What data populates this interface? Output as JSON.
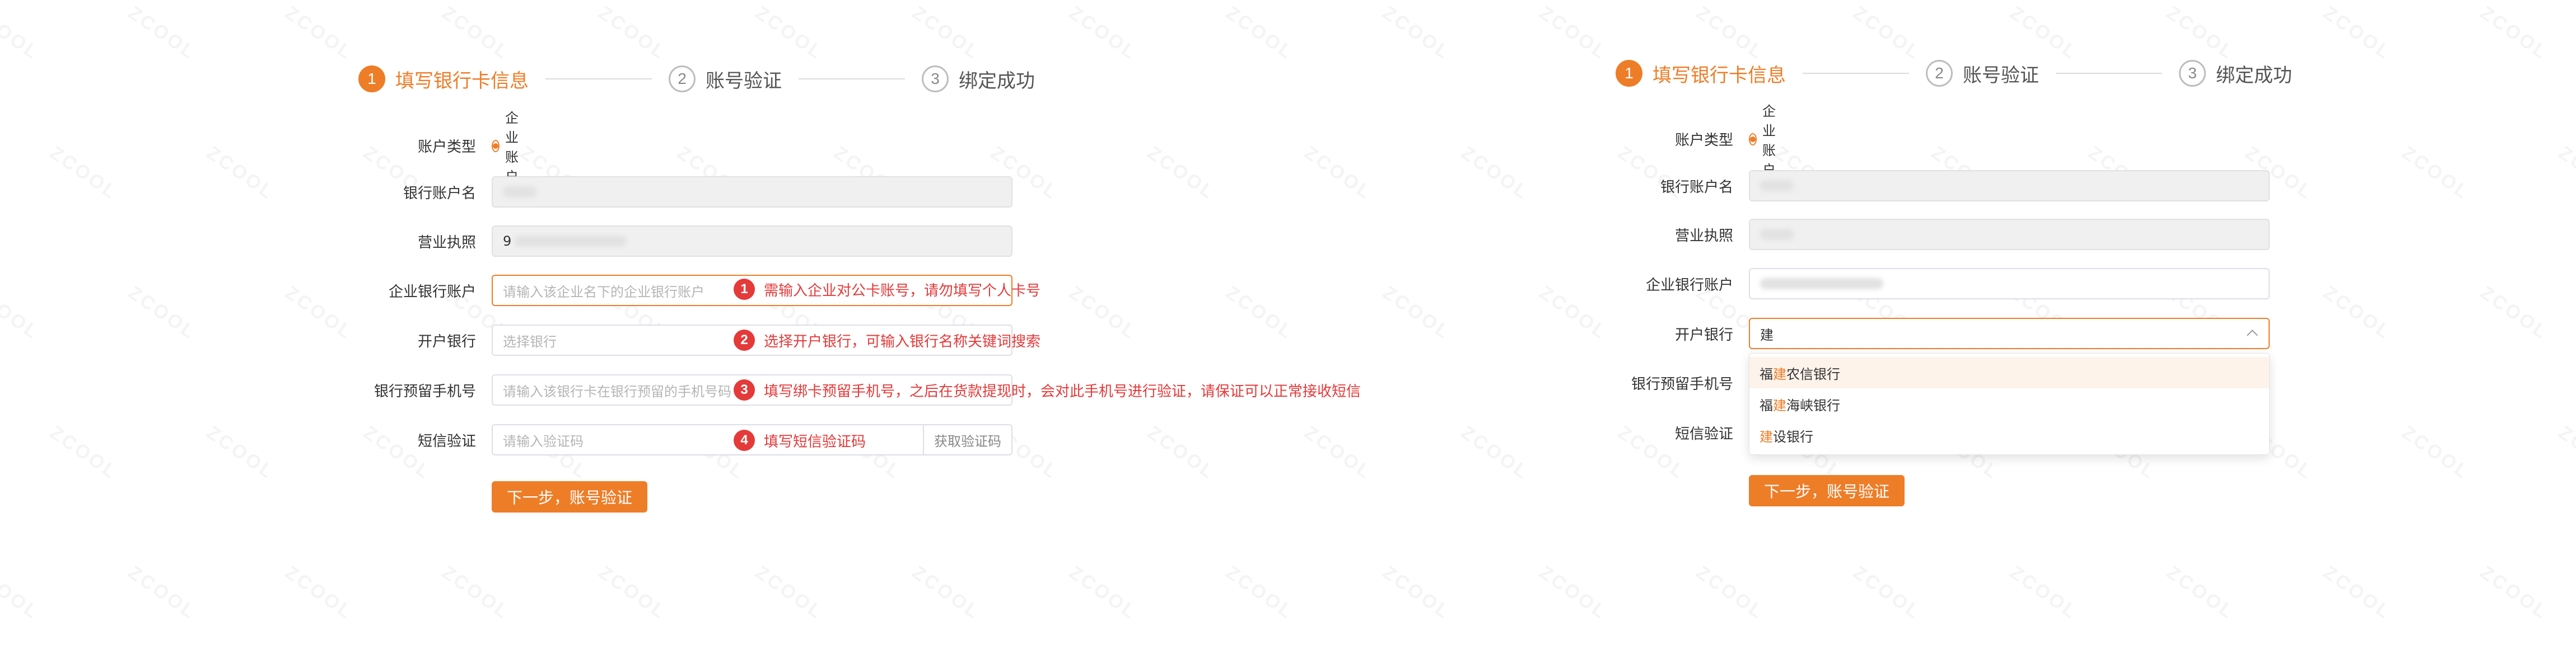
{
  "steps": [
    {
      "num": "1",
      "label": "填写银行卡信息"
    },
    {
      "num": "2",
      "label": "账号验证"
    },
    {
      "num": "3",
      "label": "绑定成功"
    }
  ],
  "form": {
    "account_type_label": "账户类型",
    "account_type_option": "企业账户",
    "account_name_label": "银行账户名",
    "license_label": "营业执照",
    "license_value_prefix": "9",
    "bank_account_label": "企业银行账户",
    "bank_account_placeholder": "请输入该企业名下的企业银行账户",
    "bank_label": "开户银行",
    "bank_placeholder": "选择银行",
    "phone_label": "银行预留手机号",
    "phone_placeholder": "请输入该银行卡在银行预留的手机号码",
    "sms_label": "短信验证",
    "sms_placeholder": "请输入验证码",
    "sms_button": "获取验证码",
    "next_button": "下一步，账号验证"
  },
  "annotations": [
    {
      "num": "1",
      "text": "需输入企业对公卡账号，请勿填写个人卡号"
    },
    {
      "num": "2",
      "text": "选择开户银行，可输入银行名称关键词搜索"
    },
    {
      "num": "3",
      "text": "填写绑卡预留手机号，之后在货款提现时，会对此手机号进行验证，请保证可以正常接收短信"
    },
    {
      "num": "4",
      "text": "填写短信验证码"
    }
  ],
  "bank_search": {
    "query": "建",
    "options": [
      {
        "pre": "福",
        "hl": "建",
        "post": "农信银行"
      },
      {
        "pre": "福",
        "hl": "建",
        "post": "海峡银行"
      },
      {
        "pre": "",
        "hl": "建",
        "post": "设银行"
      }
    ]
  },
  "watermark_text": "ZCOOL",
  "colors": {
    "accent": "#ee7d28",
    "annotation": "#e43a3a"
  }
}
